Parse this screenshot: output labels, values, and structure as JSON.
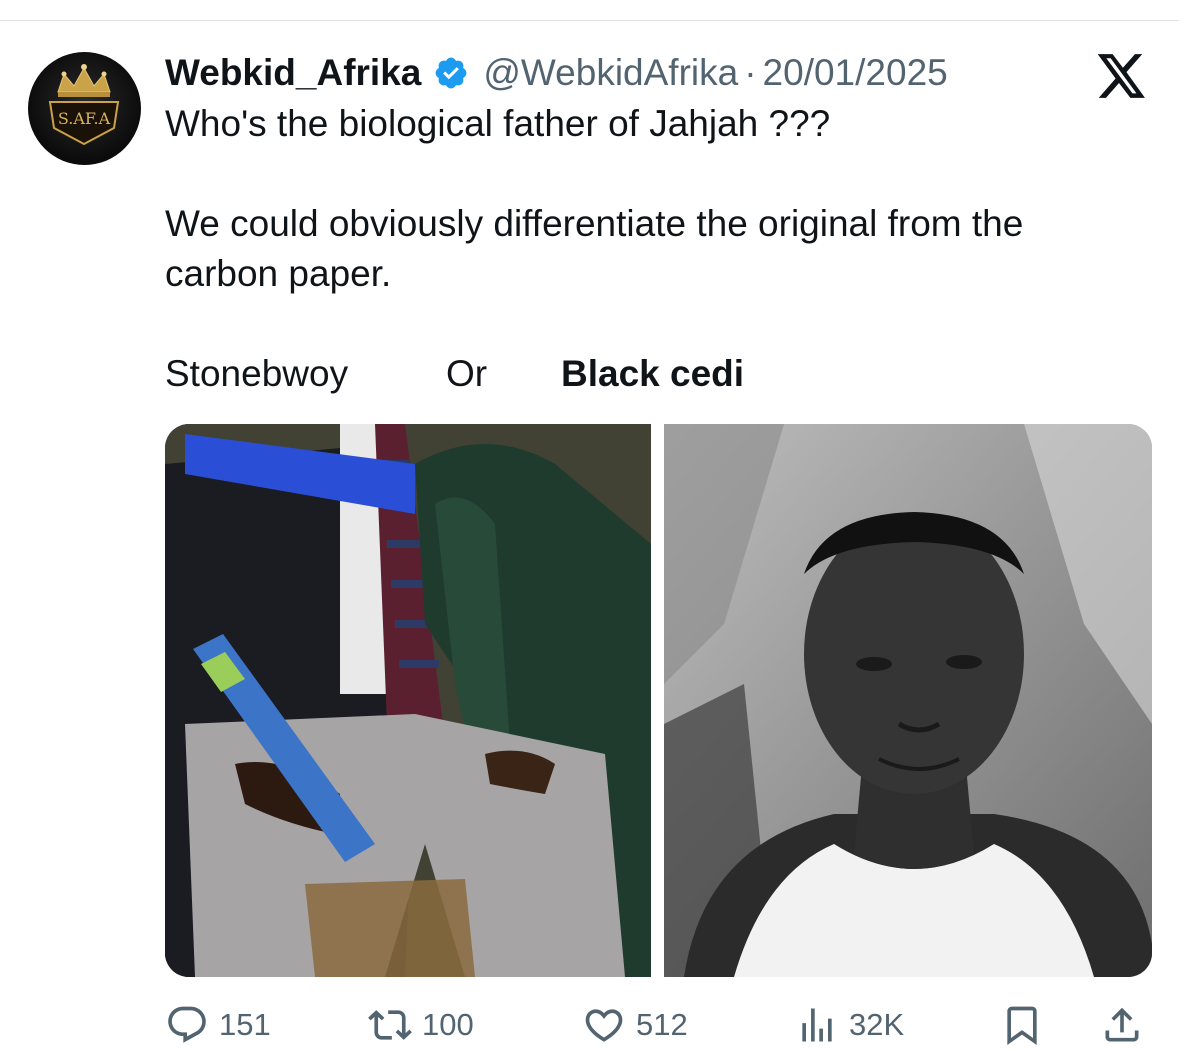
{
  "tweet": {
    "display_name": "Webkid_Afrika",
    "handle": "@WebkidAfrika",
    "separator": "·",
    "date": "20/01/2025",
    "avatar_text": "S.AF.A",
    "text_line_1": "Who's the biological father of Jahjah ???",
    "text_line_2": "We could obviously differentiate the original from the",
    "text_line_3": "carbon paper.",
    "choice_1": "Stonebwoy",
    "choice_or": "Or",
    "choice_2": "Black cedi"
  },
  "icons": {
    "verified": "verified-badge-icon",
    "x_logo": "x-logo-icon",
    "reply": "reply-icon",
    "retweet": "retweet-icon",
    "like": "heart-icon",
    "views": "views-icon",
    "bookmark": "bookmark-icon",
    "share": "share-icon"
  },
  "metrics": {
    "replies": "151",
    "retweets": "100",
    "likes": "512",
    "views": "32K"
  },
  "colors": {
    "verified_blue": "#1d9bf0",
    "secondary_text": "#536471",
    "primary_text": "#0f1419",
    "avatar_gold": "#c9a24a"
  }
}
